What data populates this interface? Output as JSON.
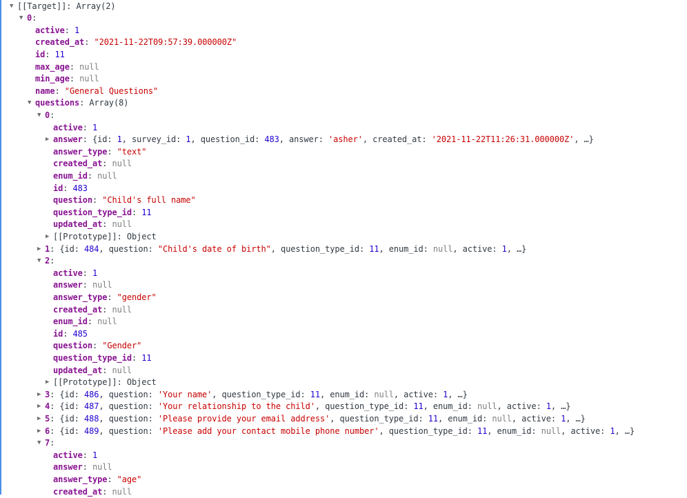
{
  "colors": {
    "key": "#881391",
    "number": "#1c00cf",
    "string": "#c80000",
    "null": "#808080",
    "text": "#303942",
    "selection_bar": "#4c8fe8"
  },
  "rows": [
    {
      "depth": 0,
      "toggle": "expanded",
      "key": "[[Target]]",
      "key_style": "plain",
      "value": [
        {
          "t": "punc",
          "v": "Array(2)"
        }
      ]
    },
    {
      "depth": 1,
      "toggle": "expanded",
      "key": "0",
      "key_style": "key",
      "value": []
    },
    {
      "depth": 2,
      "toggle": "none",
      "key": "active",
      "value": [
        {
          "t": "num",
          "v": "1"
        }
      ]
    },
    {
      "depth": 2,
      "toggle": "none",
      "key": "created_at",
      "value": [
        {
          "t": "str",
          "v": "\"2021-11-22T09:57:39.000000Z\""
        }
      ]
    },
    {
      "depth": 2,
      "toggle": "none",
      "key": "id",
      "value": [
        {
          "t": "num",
          "v": "11"
        }
      ]
    },
    {
      "depth": 2,
      "toggle": "none",
      "key": "max_age",
      "value": [
        {
          "t": "null",
          "v": "null"
        }
      ]
    },
    {
      "depth": 2,
      "toggle": "none",
      "key": "min_age",
      "value": [
        {
          "t": "null",
          "v": "null"
        }
      ]
    },
    {
      "depth": 2,
      "toggle": "none",
      "key": "name",
      "value": [
        {
          "t": "str",
          "v": "\"General Questions\""
        }
      ]
    },
    {
      "depth": 2,
      "toggle": "expanded",
      "key": "questions",
      "value": [
        {
          "t": "punc",
          "v": "Array(8)"
        }
      ]
    },
    {
      "depth": 3,
      "toggle": "expanded",
      "key": "0",
      "value": []
    },
    {
      "depth": 4,
      "toggle": "none",
      "key": "active",
      "value": [
        {
          "t": "num",
          "v": "1"
        }
      ]
    },
    {
      "depth": 4,
      "toggle": "collapsed",
      "key": "answer",
      "value": [
        {
          "t": "punc",
          "v": "{id: "
        },
        {
          "t": "num",
          "v": "1"
        },
        {
          "t": "punc",
          "v": ", survey_id: "
        },
        {
          "t": "num",
          "v": "1"
        },
        {
          "t": "punc",
          "v": ", question_id: "
        },
        {
          "t": "num",
          "v": "483"
        },
        {
          "t": "punc",
          "v": ", answer: "
        },
        {
          "t": "str",
          "v": "'asher'"
        },
        {
          "t": "punc",
          "v": ", created_at: "
        },
        {
          "t": "str",
          "v": "'2021-11-22T11:26:31.000000Z'"
        },
        {
          "t": "punc",
          "v": ", …}"
        }
      ]
    },
    {
      "depth": 4,
      "toggle": "none",
      "key": "answer_type",
      "value": [
        {
          "t": "str",
          "v": "\"text\""
        }
      ]
    },
    {
      "depth": 4,
      "toggle": "none",
      "key": "created_at",
      "value": [
        {
          "t": "null",
          "v": "null"
        }
      ]
    },
    {
      "depth": 4,
      "toggle": "none",
      "key": "enum_id",
      "value": [
        {
          "t": "null",
          "v": "null"
        }
      ]
    },
    {
      "depth": 4,
      "toggle": "none",
      "key": "id",
      "value": [
        {
          "t": "num",
          "v": "483"
        }
      ]
    },
    {
      "depth": 4,
      "toggle": "none",
      "key": "question",
      "value": [
        {
          "t": "str",
          "v": "\"Child's full name\""
        }
      ]
    },
    {
      "depth": 4,
      "toggle": "none",
      "key": "question_type_id",
      "value": [
        {
          "t": "num",
          "v": "11"
        }
      ]
    },
    {
      "depth": 4,
      "toggle": "none",
      "key": "updated_at",
      "value": [
        {
          "t": "null",
          "v": "null"
        }
      ]
    },
    {
      "depth": 4,
      "toggle": "collapsed",
      "key": "[[Prototype]]",
      "key_style": "plain",
      "value": [
        {
          "t": "punc",
          "v": "Object"
        }
      ]
    },
    {
      "depth": 3,
      "toggle": "collapsed",
      "key": "1",
      "value": [
        {
          "t": "punc",
          "v": "{id: "
        },
        {
          "t": "num",
          "v": "484"
        },
        {
          "t": "punc",
          "v": ", question: "
        },
        {
          "t": "str",
          "v": "\"Child's date of birth\""
        },
        {
          "t": "punc",
          "v": ", question_type_id: "
        },
        {
          "t": "num",
          "v": "11"
        },
        {
          "t": "punc",
          "v": ", enum_id: "
        },
        {
          "t": "null",
          "v": "null"
        },
        {
          "t": "punc",
          "v": ", active: "
        },
        {
          "t": "num",
          "v": "1"
        },
        {
          "t": "punc",
          "v": ", …}"
        }
      ]
    },
    {
      "depth": 3,
      "toggle": "expanded",
      "key": "2",
      "value": []
    },
    {
      "depth": 4,
      "toggle": "none",
      "key": "active",
      "value": [
        {
          "t": "num",
          "v": "1"
        }
      ]
    },
    {
      "depth": 4,
      "toggle": "none",
      "key": "answer",
      "value": [
        {
          "t": "null",
          "v": "null"
        }
      ]
    },
    {
      "depth": 4,
      "toggle": "none",
      "key": "answer_type",
      "value": [
        {
          "t": "str",
          "v": "\"gender\""
        }
      ]
    },
    {
      "depth": 4,
      "toggle": "none",
      "key": "created_at",
      "value": [
        {
          "t": "null",
          "v": "null"
        }
      ]
    },
    {
      "depth": 4,
      "toggle": "none",
      "key": "enum_id",
      "value": [
        {
          "t": "null",
          "v": "null"
        }
      ]
    },
    {
      "depth": 4,
      "toggle": "none",
      "key": "id",
      "value": [
        {
          "t": "num",
          "v": "485"
        }
      ]
    },
    {
      "depth": 4,
      "toggle": "none",
      "key": "question",
      "value": [
        {
          "t": "str",
          "v": "\"Gender\""
        }
      ]
    },
    {
      "depth": 4,
      "toggle": "none",
      "key": "question_type_id",
      "value": [
        {
          "t": "num",
          "v": "11"
        }
      ]
    },
    {
      "depth": 4,
      "toggle": "none",
      "key": "updated_at",
      "value": [
        {
          "t": "null",
          "v": "null"
        }
      ]
    },
    {
      "depth": 4,
      "toggle": "collapsed",
      "key": "[[Prototype]]",
      "key_style": "plain",
      "value": [
        {
          "t": "punc",
          "v": "Object"
        }
      ]
    },
    {
      "depth": 3,
      "toggle": "collapsed",
      "key": "3",
      "value": [
        {
          "t": "punc",
          "v": "{id: "
        },
        {
          "t": "num",
          "v": "486"
        },
        {
          "t": "punc",
          "v": ", question: "
        },
        {
          "t": "str",
          "v": "'Your name'"
        },
        {
          "t": "punc",
          "v": ", question_type_id: "
        },
        {
          "t": "num",
          "v": "11"
        },
        {
          "t": "punc",
          "v": ", enum_id: "
        },
        {
          "t": "null",
          "v": "null"
        },
        {
          "t": "punc",
          "v": ", active: "
        },
        {
          "t": "num",
          "v": "1"
        },
        {
          "t": "punc",
          "v": ", …}"
        }
      ]
    },
    {
      "depth": 3,
      "toggle": "collapsed",
      "key": "4",
      "value": [
        {
          "t": "punc",
          "v": "{id: "
        },
        {
          "t": "num",
          "v": "487"
        },
        {
          "t": "punc",
          "v": ", question: "
        },
        {
          "t": "str",
          "v": "'Your relationship to the child'"
        },
        {
          "t": "punc",
          "v": ", question_type_id: "
        },
        {
          "t": "num",
          "v": "11"
        },
        {
          "t": "punc",
          "v": ", enum_id: "
        },
        {
          "t": "null",
          "v": "null"
        },
        {
          "t": "punc",
          "v": ", active: "
        },
        {
          "t": "num",
          "v": "1"
        },
        {
          "t": "punc",
          "v": ", …}"
        }
      ]
    },
    {
      "depth": 3,
      "toggle": "collapsed",
      "key": "5",
      "value": [
        {
          "t": "punc",
          "v": "{id: "
        },
        {
          "t": "num",
          "v": "488"
        },
        {
          "t": "punc",
          "v": ", question: "
        },
        {
          "t": "str",
          "v": "'Please provide your email address'"
        },
        {
          "t": "punc",
          "v": ", question_type_id: "
        },
        {
          "t": "num",
          "v": "11"
        },
        {
          "t": "punc",
          "v": ", enum_id: "
        },
        {
          "t": "null",
          "v": "null"
        },
        {
          "t": "punc",
          "v": ", active: "
        },
        {
          "t": "num",
          "v": "1"
        },
        {
          "t": "punc",
          "v": ", …}"
        }
      ]
    },
    {
      "depth": 3,
      "toggle": "collapsed",
      "key": "6",
      "value": [
        {
          "t": "punc",
          "v": "{id: "
        },
        {
          "t": "num",
          "v": "489"
        },
        {
          "t": "punc",
          "v": ", question: "
        },
        {
          "t": "str",
          "v": "'Please add your contact mobile phone number'"
        },
        {
          "t": "punc",
          "v": ", question_type_id: "
        },
        {
          "t": "num",
          "v": "11"
        },
        {
          "t": "punc",
          "v": ", enum_id: "
        },
        {
          "t": "null",
          "v": "null"
        },
        {
          "t": "punc",
          "v": ", active: "
        },
        {
          "t": "num",
          "v": "1"
        },
        {
          "t": "punc",
          "v": ", …}"
        }
      ]
    },
    {
      "depth": 3,
      "toggle": "expanded",
      "key": "7",
      "value": []
    },
    {
      "depth": 4,
      "toggle": "none",
      "key": "active",
      "value": [
        {
          "t": "num",
          "v": "1"
        }
      ]
    },
    {
      "depth": 4,
      "toggle": "none",
      "key": "answer",
      "value": [
        {
          "t": "null",
          "v": "null"
        }
      ]
    },
    {
      "depth": 4,
      "toggle": "none",
      "key": "answer_type",
      "value": [
        {
          "t": "str",
          "v": "\"age\""
        }
      ]
    },
    {
      "depth": 4,
      "toggle": "none",
      "key": "created_at",
      "value": [
        {
          "t": "null",
          "v": "null"
        }
      ]
    }
  ]
}
